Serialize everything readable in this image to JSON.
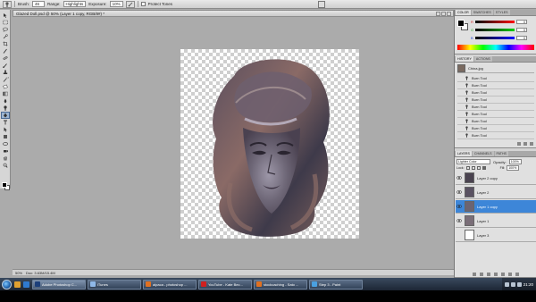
{
  "options_bar": {
    "brush_label": "Brush:",
    "brush_size": "46",
    "range_label": "Range:",
    "range_value": "Highlights",
    "exposure_label": "Exposure:",
    "exposure_value": "10%",
    "protect_tones_label": "Protect Tones"
  },
  "document": {
    "title": "Glazed Doll.psd @ 50% (Layer 1 copy, RGB/8#) *",
    "zoom": "50%",
    "doc_size": "Doc: 3.63M/15.4M"
  },
  "panels": {
    "color": {
      "tabs": [
        "COLOR",
        "SWATCHES",
        "STYLES"
      ],
      "channels": [
        {
          "name": "R",
          "value": "0",
          "color": "#d02020"
        },
        {
          "name": "G",
          "value": "0",
          "color": "#20a020"
        },
        {
          "name": "B",
          "value": "0",
          "color": "#2040d0"
        }
      ]
    },
    "history": {
      "tabs": [
        "HISTORY",
        "ACTIONS"
      ],
      "snapshot": "China.jpg",
      "items": [
        "Burn Tool",
        "Burn Tool",
        "Burn Tool",
        "Burn Tool",
        "Burn Tool",
        "Burn Tool",
        "Burn Tool",
        "Burn Tool",
        "Burn Tool"
      ]
    },
    "layers": {
      "tabs": [
        "LAYERS",
        "CHANNELS",
        "PATHS"
      ],
      "blend_mode": "Lighter Color",
      "opacity_label": "Opacity:",
      "opacity": "100%",
      "lock_label": "Lock:",
      "fill_label": "Fill:",
      "fill": "100%",
      "items": [
        {
          "name": "Layer 2 copy",
          "visible": true
        },
        {
          "name": "Layer 2",
          "visible": true
        },
        {
          "name": "Layer 1 copy",
          "visible": true,
          "selected": true
        },
        {
          "name": "Layer 1",
          "visible": true
        },
        {
          "name": "Layer 3",
          "visible": false
        }
      ]
    }
  },
  "taskbar": {
    "buttons": [
      {
        "label": "Adobe Photoshop C...",
        "icon_color": "#1c3f7a",
        "active": true
      },
      {
        "label": "iTunes",
        "icon_color": "#8fb8e8"
      },
      {
        "label": "alpaca - photoshop ...",
        "icon_color": "#e07020"
      },
      {
        "label": "YouTube - Kate Bec...",
        "icon_color": "#d02020"
      },
      {
        "label": "stockcaching - Sato ...",
        "icon_color": "#e07020"
      },
      {
        "label": "Step 3 - Paint",
        "icon_color": "#4aa0e0"
      }
    ],
    "clock": "21:20"
  }
}
